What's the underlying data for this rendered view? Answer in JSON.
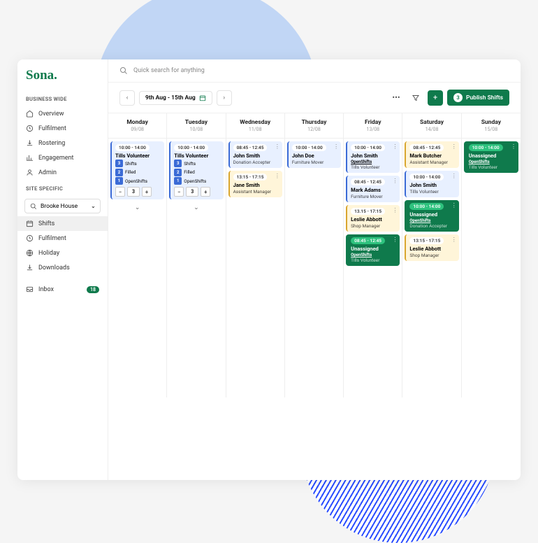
{
  "brand": "Sona.",
  "search": {
    "placeholder": "Quick search for anything"
  },
  "sidebar": {
    "section1": "BUSINESS WIDE",
    "business": [
      "Overview",
      "Fulfilment",
      "Rostering",
      "Engagement",
      "Admin"
    ],
    "section2": "SITE SPECIFIC",
    "site": "Brooke House",
    "siteItems": [
      "Shifts",
      "Fulfilment",
      "Holiday",
      "Downloads"
    ],
    "inbox": {
      "label": "Inbox",
      "count": "18"
    }
  },
  "toolbar": {
    "range": "9th Aug - 15th Aug",
    "publishCount": "3",
    "publishLabel": "Publish Shifts"
  },
  "colors": {
    "accent": "#0f7a4c",
    "blue": "#e8f0ff",
    "yellow": "#fff5d9"
  },
  "days": [
    {
      "name": "Monday",
      "date": "09/08",
      "cards": [
        {
          "type": "volunteer",
          "color": "blue",
          "time": "10:00 - 14:00",
          "title": "Tills Volunteer",
          "stats": [
            {
              "n": "3",
              "label": "Shifts"
            },
            {
              "n": "2",
              "label": "Filled"
            },
            {
              "n": "1",
              "label": "OpenShifts"
            }
          ],
          "stepper": 3,
          "expand": true
        }
      ]
    },
    {
      "name": "Tuesday",
      "date": "10/08",
      "cards": [
        {
          "type": "volunteer",
          "color": "blue",
          "time": "10:00 - 14:00",
          "title": "Tills Volunteer",
          "stats": [
            {
              "n": "3",
              "label": "Shifts"
            },
            {
              "n": "2",
              "label": "Filled"
            },
            {
              "n": "1",
              "label": "OpenShifts"
            }
          ],
          "stepper": 3,
          "expand": true
        }
      ]
    },
    {
      "name": "Wednesday",
      "date": "11/08",
      "cards": [
        {
          "type": "shift",
          "color": "blue",
          "time": "08:45 - 12:45",
          "title": "John Smith",
          "sub": "Donation Accepter",
          "dots": true
        },
        {
          "type": "shift",
          "color": "yellow",
          "time": "13:15 - 17:15",
          "title": "Jane Smith",
          "sub": "Assistant Manager",
          "dots": true
        }
      ]
    },
    {
      "name": "Thursday",
      "date": "12/08",
      "cards": [
        {
          "type": "shift",
          "color": "blue",
          "time": "10:00 - 14:00",
          "title": "John Doe",
          "sub": "Furniture Mover",
          "dots": true
        }
      ]
    },
    {
      "name": "Friday",
      "date": "13/08",
      "cards": [
        {
          "type": "shift",
          "color": "blue",
          "time": "10:00 - 14:00",
          "title": "John Smith",
          "open": "OpenShifts",
          "sub": "Tills Volunteer",
          "dots": true
        },
        {
          "type": "shift",
          "color": "blue",
          "time": "08:45 - 12:45",
          "title": "Mark Adams",
          "sub": "Furniture Mover",
          "dots": true
        },
        {
          "type": "shift",
          "color": "yellow",
          "time": "13.15 - 17:15",
          "title": "Leslie Abbott",
          "sub": "Shop Manager",
          "dots": true
        },
        {
          "type": "shift",
          "color": "green",
          "time": "08:45 - 12:45",
          "title": "Unassigned",
          "open": "OpenShifts",
          "sub": "Tills Volunteer",
          "dots": true
        }
      ]
    },
    {
      "name": "Saturday",
      "date": "14/08",
      "cards": [
        {
          "type": "shift",
          "color": "yellow",
          "time": "08:45 - 12:45",
          "title": "Mark Butcher",
          "sub": "Assistant Manager",
          "dots": true
        },
        {
          "type": "shift",
          "color": "blue",
          "time": "10:00 - 14:00",
          "title": "John Smith",
          "sub": "Tills Volunteer",
          "dots": true
        },
        {
          "type": "shift",
          "color": "green",
          "time": "10:00 - 14:00",
          "title": "Unassigned",
          "open": "OpenShifts",
          "sub": "Donation Accepter",
          "dots": true
        },
        {
          "type": "shift",
          "color": "yellow",
          "time": "13:15 - 17:15",
          "title": "Leslie Abbott",
          "sub": "Shop Manager",
          "dots": true
        }
      ]
    },
    {
      "name": "Sunday",
      "date": "15/08",
      "cards": [
        {
          "type": "shift",
          "color": "green",
          "time": "10:00 - 14:00",
          "title": "Unassigned",
          "open": "OpenShifts",
          "sub": "Tills Volunteer",
          "dots": true
        }
      ]
    }
  ]
}
